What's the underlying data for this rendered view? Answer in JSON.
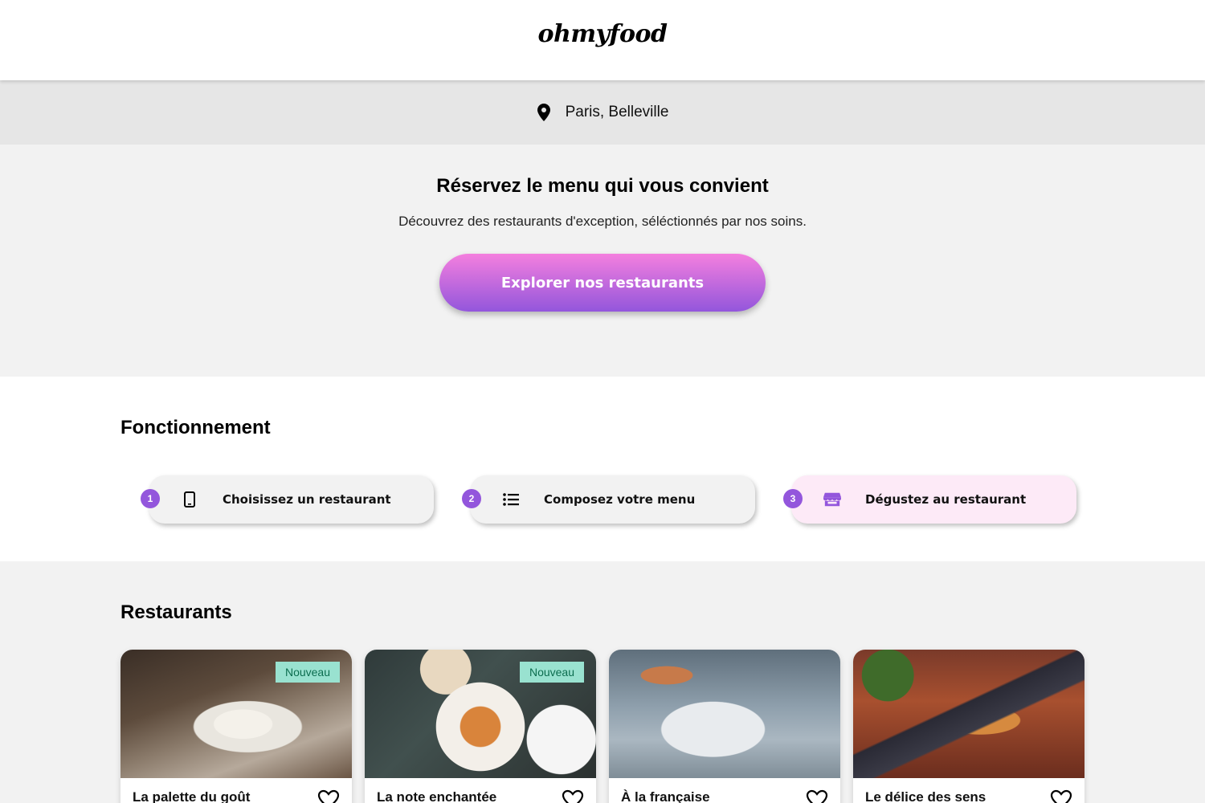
{
  "header": {
    "logo": "ohmyfood"
  },
  "location": {
    "text": "Paris, Belleville",
    "icon": "map-pin-icon"
  },
  "hero": {
    "title": "Réservez le menu qui vous convient",
    "subtitle": "Découvrez des restaurants d'exception, séléctionnés par nos soins.",
    "cta_label": "Explorer nos restaurants"
  },
  "how": {
    "title": "Fonctionnement",
    "steps": [
      {
        "number": "1",
        "label": "Choisissez un restaurant",
        "icon": "smartphone-icon"
      },
      {
        "number": "2",
        "label": "Composez votre menu",
        "icon": "list-icon"
      },
      {
        "number": "3",
        "label": "Dégustez au restaurant",
        "icon": "store-icon"
      }
    ]
  },
  "restaurants": {
    "title": "Restaurants",
    "items": [
      {
        "name": "La palette du goût",
        "badge": "Nouveau"
      },
      {
        "name": "La note enchantée",
        "badge": "Nouveau"
      },
      {
        "name": "À la française",
        "badge": ""
      },
      {
        "name": "Le délice des sens",
        "badge": ""
      }
    ]
  },
  "colors": {
    "accent_purple": "#9356dc",
    "accent_pink": "#ff79da",
    "badge_bg": "#99e2d0",
    "badge_text": "#0c6d4f"
  }
}
